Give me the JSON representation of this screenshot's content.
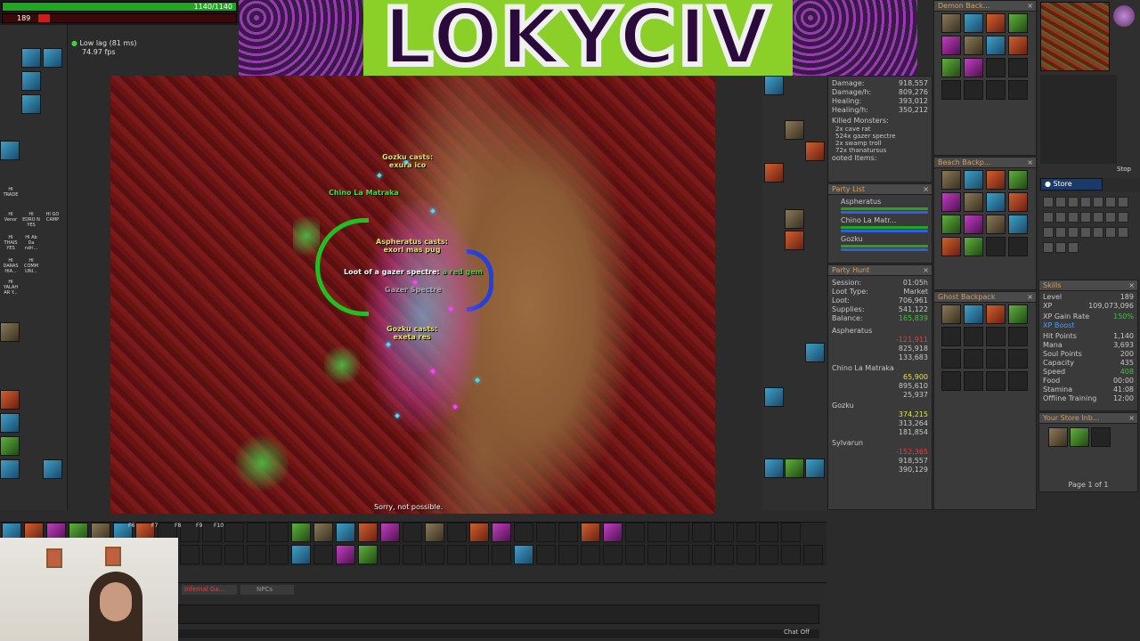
{
  "top_bars": {
    "health": "1140/1140",
    "health_fraction": 1.0,
    "mana_value": "189",
    "mana_fraction": 0.05
  },
  "status": {
    "lag": "Low lag (81 ms)",
    "fps": "74.97 fps"
  },
  "banner": {
    "text": "LOKYCIV"
  },
  "game_messages": {
    "gozku1_name": "Gozku casts:",
    "gozku1_spell": "exura ico",
    "chino_name": "Chino La Matraka",
    "asph_name": "Aspheratus casts:",
    "asph_spell": "exori mas pug",
    "loot_prefix": "Loot of a gazer spectre:",
    "loot_item": "a red gem",
    "gazer": "Gazer Spectre",
    "gozku2_name": "Gozku casts:",
    "gozku2_spell": "exeta res",
    "sorry": "Sorry, not possible."
  },
  "analyzer": {
    "damage_label": "Damage:",
    "damage": "918,557",
    "dmgh_label": "Damage/h:",
    "dmgh": "809,276",
    "heal_label": "Healing:",
    "heal": "393,012",
    "healh_label": "Healing/h:",
    "healh": "350,212",
    "killed_title": "Killed Monsters:",
    "killed": [
      "2x cave rat",
      "524x gazer spectre",
      "2x swamp troll",
      "72x thanatursus"
    ],
    "looted_title": "ooted Items:"
  },
  "party_list": {
    "title": "Party List",
    "members": [
      "Aspheratus",
      "Chino La Matr...",
      "Gozku"
    ]
  },
  "party_hunt": {
    "title": "Party Hunt",
    "session_label": "Session:",
    "session": "01:05h",
    "loot_type_label": "Loot Type:",
    "loot_type": "Market",
    "loot_label": "Loot:",
    "loot": "706,961",
    "supplies_label": "Supplies:",
    "supplies": "541,122",
    "balance_label": "Balance:",
    "balance": "165,839",
    "members": [
      {
        "name": "Aspheratus",
        "balance": "-121,911",
        "damage": "825,918",
        "healing": "133,683"
      },
      {
        "name": "Chino La Matraka",
        "balance": "65,900",
        "damage": "895,610",
        "healing": "25,937"
      },
      {
        "name": "Gozku",
        "balance": "374,215",
        "damage": "313,264",
        "healing": "181,854"
      },
      {
        "name": "Sylvarun",
        "balance": "-152,365",
        "damage": "918,557",
        "healing": "390,129"
      }
    ]
  },
  "containers": {
    "demon": "Demon Back...",
    "beach": "Beach Backp...",
    "ghost": "Ghost Backpack",
    "store_inbox": "Your Store Inb...",
    "page": "Page 1 of 1",
    "store_button": "Store",
    "stop": "Stop"
  },
  "skills": {
    "title": "Skills",
    "rows": [
      {
        "label": "Level",
        "value": "189"
      },
      {
        "label": "XP",
        "value": "109,073,096"
      },
      {
        "label": "XP Gain Rate",
        "value": "150%"
      },
      {
        "label": "XP Boost",
        "value": ""
      },
      {
        "label": "Hit Points",
        "value": "1,140"
      },
      {
        "label": "Mana",
        "value": "3,693"
      },
      {
        "label": "Soul Points",
        "value": "200"
      },
      {
        "label": "Capacity",
        "value": "435"
      },
      {
        "label": "Speed",
        "value": "408"
      },
      {
        "label": "Food",
        "value": "00:00"
      },
      {
        "label": "Stamina",
        "value": "41:08"
      },
      {
        "label": "Offline Training",
        "value": "12:00"
      }
    ]
  },
  "chat": {
    "tab1": "Infernal Ga...",
    "tab2": "NPCs",
    "chat_off": "Chat Off"
  },
  "hotkeys": {
    "f6": "F6",
    "f7": "F7",
    "f8": "F8",
    "f9": "F9",
    "f10": "F10"
  },
  "side_labels": {
    "trade": "HI TRADE",
    "l1": "HI Venor",
    "l2": "HI EDRO N YES",
    "l3": "HI GO CAMP",
    "l4": "HI THAIS YES",
    "l5": "HI Ab Da ndri...",
    "l6": "HI DARAS HIA...",
    "l7": "HI COMM UNI...",
    "l8": "HI YALAH AR Y..."
  },
  "colors": {
    "health": "#1fa81f",
    "mana": "#c81e1e",
    "party_title": "#d0a060"
  }
}
